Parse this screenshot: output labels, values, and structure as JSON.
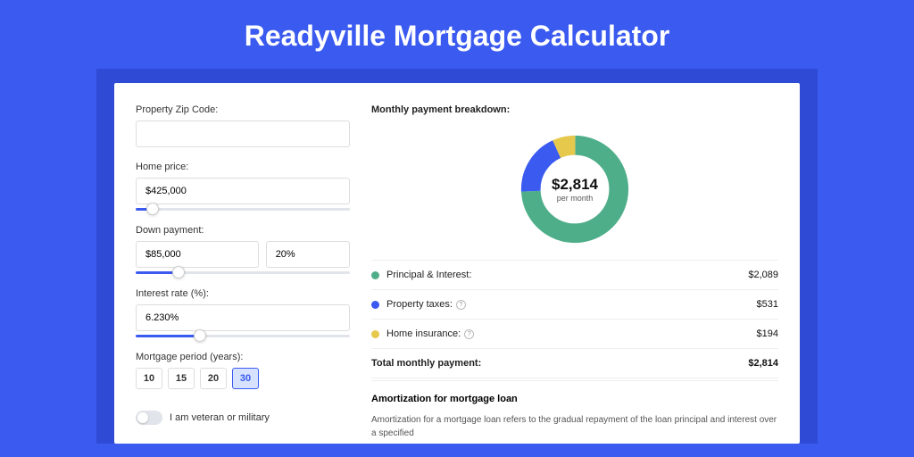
{
  "page": {
    "title": "Readyville Mortgage Calculator"
  },
  "form": {
    "zip_label": "Property Zip Code:",
    "zip_value": "",
    "home_price_label": "Home price:",
    "home_price_value": "$425,000",
    "down_payment_label": "Down payment:",
    "down_payment_value": "$85,000",
    "down_payment_pct": "20%",
    "interest_label": "Interest rate (%):",
    "interest_value": "6.230%",
    "period_label": "Mortgage period (years):",
    "periods": [
      "10",
      "15",
      "20",
      "30"
    ],
    "period_selected": "30",
    "veteran_label": "I am veteran or military"
  },
  "breakdown": {
    "title": "Monthly payment breakdown:",
    "center_amount": "$2,814",
    "center_sub": "per month",
    "legend": [
      {
        "color": "g",
        "label": "Principal & Interest:",
        "value": "$2,089",
        "info": false
      },
      {
        "color": "b",
        "label": "Property taxes:",
        "value": "$531",
        "info": true
      },
      {
        "color": "y",
        "label": "Home insurance:",
        "value": "$194",
        "info": true
      }
    ],
    "total_label": "Total monthly payment:",
    "total_value": "$2,814"
  },
  "amortization": {
    "title": "Amortization for mortgage loan",
    "body": "Amortization for a mortgage loan refers to the gradual repayment of the loan principal and interest over a specified"
  },
  "chart_data": {
    "type": "pie",
    "title": "Monthly payment breakdown",
    "series": [
      {
        "name": "Principal & Interest",
        "value": 2089,
        "color": "#4fae8a"
      },
      {
        "name": "Property taxes",
        "value": 531,
        "color": "#3a5af0"
      },
      {
        "name": "Home insurance",
        "value": 194,
        "color": "#e6c84c"
      }
    ],
    "total": 2814,
    "center_label": "$2,814 per month"
  },
  "sliders": {
    "home_price_pct": 8,
    "down_payment_pct": 20,
    "interest_pct": 30
  }
}
